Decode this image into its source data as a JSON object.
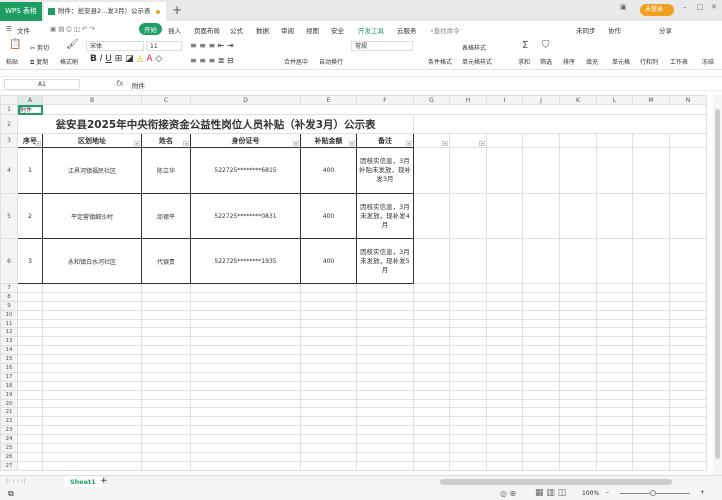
{
  "titlebar": {
    "app": "WPS 表格",
    "doc_tab": "附件：瓮安县2...发3月）公示表",
    "new_tab": "+",
    "login": "未登录"
  },
  "menu": {
    "file": "文件",
    "items": [
      "开始",
      "插入",
      "页面布局",
      "公式",
      "数据",
      "审阅",
      "视图",
      "安全",
      "开发工具",
      "云服务"
    ],
    "search": "查找命令",
    "sync": "未同步",
    "collab": "协作",
    "share": "分享"
  },
  "toolbar": {
    "paste": "粘贴",
    "cut": "剪切",
    "copy": "复制",
    "format_painter": "格式刷",
    "font": "宋体",
    "size": "11",
    "merge": "合并居中",
    "wrap": "自动换行",
    "number_format": "常规",
    "cond_format": "条件格式",
    "table_style": "表格样式",
    "cell_style": "单元格样式",
    "sum": "求和",
    "filter": "筛选",
    "sort": "排序",
    "fill": "填充",
    "cell": "单元格",
    "rowcol": "行和列",
    "sheet": "工作表",
    "freeze": "冻结"
  },
  "formula_bar": {
    "cell_ref": "A1",
    "fx": "fx",
    "value": "附件"
  },
  "columns": [
    "A",
    "B",
    "C",
    "D",
    "E",
    "F",
    "G",
    "H",
    "I",
    "J",
    "K",
    "L",
    "M",
    "N"
  ],
  "sheet": {
    "a1": "附件",
    "title": "瓮安县2025年中央衔接资金公益性岗位人员补贴（补发3月）公示表",
    "headers": [
      "序号",
      "区划地址",
      "姓名",
      "身份证号",
      "补贴金额",
      "备注"
    ],
    "rows": [
      [
        "1",
        "江界河镇福民社区",
        "陈立华",
        "522725********6815",
        "400",
        "因核实信息，3月补贴未发放，现补发3月"
      ],
      [
        "2",
        "平定营镇细沙村",
        "邱德平",
        "522725********0831",
        "400",
        "因核实信息，3月未发放，现补发4月"
      ],
      [
        "3",
        "永和镇白水河社区",
        "代银贵",
        "522725********1935",
        "400",
        "因核实信息，3月未发放，现补发5月"
      ]
    ]
  },
  "sheet_tabs": [
    "Sheet1"
  ],
  "status": {
    "zoom": "100%"
  }
}
